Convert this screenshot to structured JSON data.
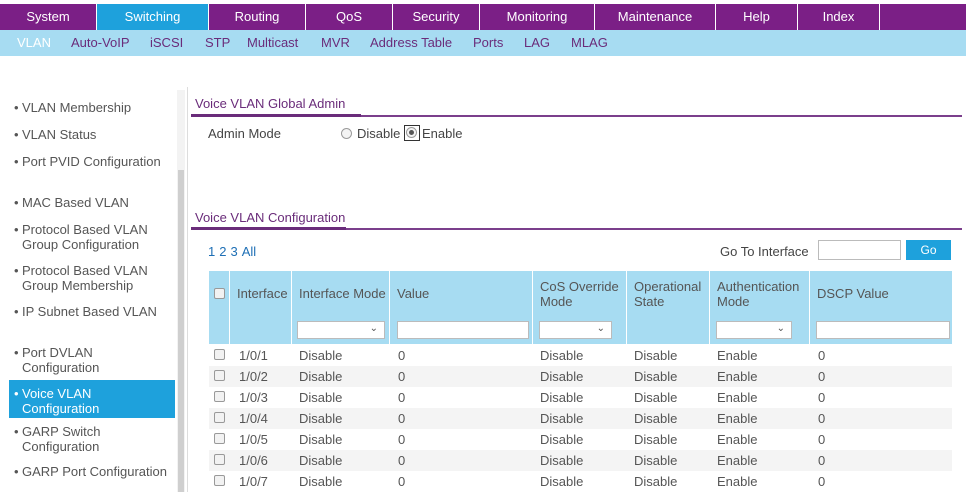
{
  "top_tabs": [
    "System",
    "Switching",
    "Routing",
    "QoS",
    "Security",
    "Monitoring",
    "Maintenance",
    "Help",
    "Index"
  ],
  "sub_tabs": [
    "VLAN",
    "Auto-VoIP",
    "iSCSI",
    "STP",
    "Multicast",
    "MVR",
    "Address Table",
    "Ports",
    "LAG",
    "MLAG"
  ],
  "sidebar": [
    "VLAN Membership",
    "VLAN Status",
    "Port PVID Configuration",
    "MAC Based VLAN",
    "Protocol Based VLAN Group Configuration",
    "Protocol Based VLAN Group Membership",
    "IP Subnet Based VLAN",
    "Port DVLAN Configuration",
    "Voice VLAN Configuration",
    "GARP Switch Configuration",
    "GARP Port Configuration"
  ],
  "global": {
    "title": "Voice VLAN Global Admin",
    "admin_mode_label": "Admin Mode",
    "disable_label": "Disable",
    "enable_label": "Enable",
    "selected": "Enable"
  },
  "config": {
    "title": "Voice VLAN Configuration",
    "pages": [
      "1",
      "2",
      "3",
      "All"
    ],
    "goto_label": "Go To Interface",
    "go_button": "Go"
  },
  "table": {
    "headers": {
      "interface": "Interface",
      "interface_mode": "Interface Mode",
      "value": "Value",
      "cos_override_mode": "CoS Override Mode",
      "operational_state": "Operational State",
      "authentication_mode": "Authentication Mode",
      "dscp_value": "DSCP Value"
    },
    "rows": [
      {
        "interface": "1/0/1",
        "interface_mode": "Disable",
        "value": "0",
        "cos_override_mode": "Disable",
        "operational_state": "Disable",
        "authentication_mode": "Enable",
        "dscp_value": "0"
      },
      {
        "interface": "1/0/2",
        "interface_mode": "Disable",
        "value": "0",
        "cos_override_mode": "Disable",
        "operational_state": "Disable",
        "authentication_mode": "Enable",
        "dscp_value": "0"
      },
      {
        "interface": "1/0/3",
        "interface_mode": "Disable",
        "value": "0",
        "cos_override_mode": "Disable",
        "operational_state": "Disable",
        "authentication_mode": "Enable",
        "dscp_value": "0"
      },
      {
        "interface": "1/0/4",
        "interface_mode": "Disable",
        "value": "0",
        "cos_override_mode": "Disable",
        "operational_state": "Disable",
        "authentication_mode": "Enable",
        "dscp_value": "0"
      },
      {
        "interface": "1/0/5",
        "interface_mode": "Disable",
        "value": "0",
        "cos_override_mode": "Disable",
        "operational_state": "Disable",
        "authentication_mode": "Enable",
        "dscp_value": "0"
      },
      {
        "interface": "1/0/6",
        "interface_mode": "Disable",
        "value": "0",
        "cos_override_mode": "Disable",
        "operational_state": "Disable",
        "authentication_mode": "Enable",
        "dscp_value": "0"
      },
      {
        "interface": "1/0/7",
        "interface_mode": "Disable",
        "value": "0",
        "cos_override_mode": "Disable",
        "operational_state": "Disable",
        "authentication_mode": "Enable",
        "dscp_value": "0"
      }
    ]
  },
  "colors": {
    "nav_purple": "#7b1f86",
    "active_blue": "#1ea1dc",
    "subnav_light_blue": "#a7dcf2",
    "section_title": "#6a2c7a",
    "link_blue": "#1e6fb5"
  }
}
